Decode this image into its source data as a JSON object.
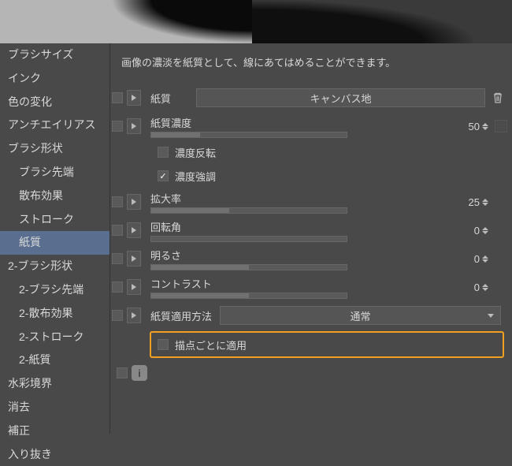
{
  "sidebar": {
    "items": [
      {
        "label": "ブラシサイズ",
        "indent": false
      },
      {
        "label": "インク",
        "indent": false
      },
      {
        "label": "色の変化",
        "indent": false
      },
      {
        "label": "アンチエイリアス",
        "indent": false
      },
      {
        "label": "ブラシ形状",
        "indent": false
      },
      {
        "label": "ブラシ先端",
        "indent": true
      },
      {
        "label": "散布効果",
        "indent": true
      },
      {
        "label": "ストローク",
        "indent": true
      },
      {
        "label": "紙質",
        "indent": true,
        "selected": true
      },
      {
        "label": "2-ブラシ形状",
        "indent": false
      },
      {
        "label": "2-ブラシ先端",
        "indent": true
      },
      {
        "label": "2-散布効果",
        "indent": true
      },
      {
        "label": "2-ストローク",
        "indent": true
      },
      {
        "label": "2-紙質",
        "indent": true
      },
      {
        "label": "水彩境界",
        "indent": false
      },
      {
        "label": "消去",
        "indent": false
      },
      {
        "label": "補正",
        "indent": false
      },
      {
        "label": "入り抜き",
        "indent": false
      }
    ]
  },
  "content": {
    "description": "画像の濃淡を紙質として、線にあてはめることができます。",
    "texture_label": "紙質",
    "texture_value": "キャンバス地",
    "density_label": "紙質濃度",
    "density_value": "50",
    "invert_label": "濃度反転",
    "emphasize_label": "濃度強調",
    "scale_label": "拡大率",
    "scale_value": "25",
    "rotation_label": "回転角",
    "rotation_value": "0",
    "brightness_label": "明るさ",
    "brightness_value": "0",
    "contrast_label": "コントラスト",
    "contrast_value": "0",
    "apply_method_label": "紙質適用方法",
    "apply_method_value": "通常",
    "apply_per_point_label": "描点ごとに適用"
  }
}
